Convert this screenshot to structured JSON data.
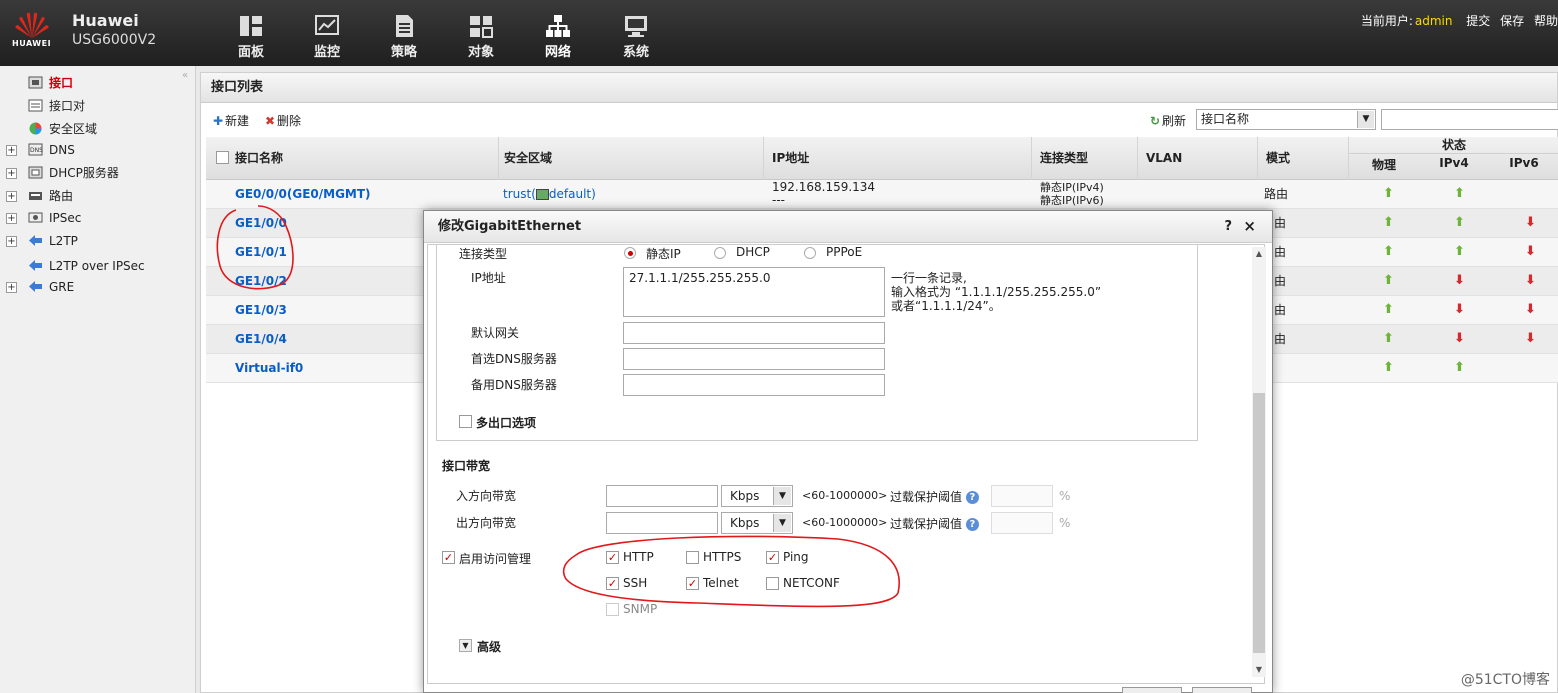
{
  "header": {
    "logo_text": "HUAWEI",
    "brand": "Huawei",
    "model": "USG6000V2",
    "nav": [
      {
        "label": "面板",
        "icon": "dashboard-icon"
      },
      {
        "label": "监控",
        "icon": "monitor-icon"
      },
      {
        "label": "策略",
        "icon": "policy-icon"
      },
      {
        "label": "对象",
        "icon": "object-icon"
      },
      {
        "label": "网络",
        "icon": "network-icon"
      },
      {
        "label": "系统",
        "icon": "system-icon"
      }
    ],
    "user_label": "当前用户:",
    "user_name": "admin",
    "submit": "提交",
    "save": "保存",
    "help": "帮助"
  },
  "tree": [
    {
      "label": "接口",
      "expandable": false
    },
    {
      "label": "接口对",
      "expandable": false
    },
    {
      "label": "安全区域",
      "expandable": false
    },
    {
      "label": "DNS",
      "expandable": true
    },
    {
      "label": "DHCP服务器",
      "expandable": true
    },
    {
      "label": "路由",
      "expandable": true
    },
    {
      "label": "IPSec",
      "expandable": true
    },
    {
      "label": "L2TP",
      "expandable": true
    },
    {
      "label": "L2TP over IPSec",
      "expandable": false
    },
    {
      "label": "GRE",
      "expandable": true
    }
  ],
  "main": {
    "title": "接口列表",
    "new": "新建",
    "delete": "删除",
    "refresh": "刷新",
    "search_field": "接口名称",
    "columns": {
      "name": "接口名称",
      "zone": "安全区域",
      "ip": "IP地址",
      "conn_type": "连接类型",
      "vlan": "VLAN",
      "mode": "模式",
      "status": "状态",
      "physical": "物理",
      "ipv4": "IPv4",
      "ipv6": "IPv6"
    },
    "rows": [
      {
        "name": "GE0/0/0(GE0/MGMT)",
        "zone": "trust(",
        "zone2": "default)",
        "ip": "192.168.159.134",
        "ip2": "---",
        "conn": "静态IP(IPv4)",
        "conn2": "静态IP(IPv6)",
        "mode": "路由",
        "phy": "up",
        "v4": "up",
        "v6": ""
      },
      {
        "name": "GE1/0/0",
        "mode": "由",
        "phy": "up",
        "v4": "up",
        "v6": "down"
      },
      {
        "name": "GE1/0/1",
        "mode": "由",
        "phy": "up",
        "v4": "up",
        "v6": "down"
      },
      {
        "name": "GE1/0/2",
        "mode": "由",
        "phy": "up",
        "v4": "down",
        "v6": "down"
      },
      {
        "name": "GE1/0/3",
        "mode": "由",
        "phy": "up",
        "v4": "down",
        "v6": "down"
      },
      {
        "name": "GE1/0/4",
        "mode": "由",
        "phy": "up",
        "v4": "down",
        "v6": "down"
      },
      {
        "name": "Virtual-if0",
        "mode": "",
        "phy": "up",
        "v4": "up",
        "v6": ""
      }
    ]
  },
  "dialog": {
    "title": "修改GigabitEthernet",
    "help": "?",
    "close": "×",
    "conn_type_label": "连接类型",
    "radio_static": "静态IP",
    "radio_dhcp": "DHCP",
    "radio_pppoe": "PPPoE",
    "ip_label": "IP地址",
    "ip_value": "27.1.1.1/255.255.255.0",
    "ip_hint1": "一行一条记录,",
    "ip_hint2": "输入格式为 “1.1.1.1/255.255.255.0”",
    "ip_hint3": "或者“1.1.1.1/24”。",
    "gateway_label": "默认网关",
    "dns1_label": "首选DNS服务器",
    "dns2_label": "备用DNS服务器",
    "multi_exit": "多出口选项",
    "bandwidth_title": "接口带宽",
    "in_bw": "入方向带宽",
    "out_bw": "出方向带宽",
    "unit": "Kbps",
    "range": "<60-1000000>",
    "overload": "过载保护阈值",
    "percent": "%",
    "access_mgmt": "启用访问管理",
    "svc": {
      "http": "HTTP",
      "https": "HTTPS",
      "ping": "Ping",
      "ssh": "SSH",
      "telnet": "Telnet",
      "netconf": "NETCONF",
      "snmp": "SNMP"
    },
    "advanced": "高级"
  },
  "watermark": "@51CTO博客"
}
